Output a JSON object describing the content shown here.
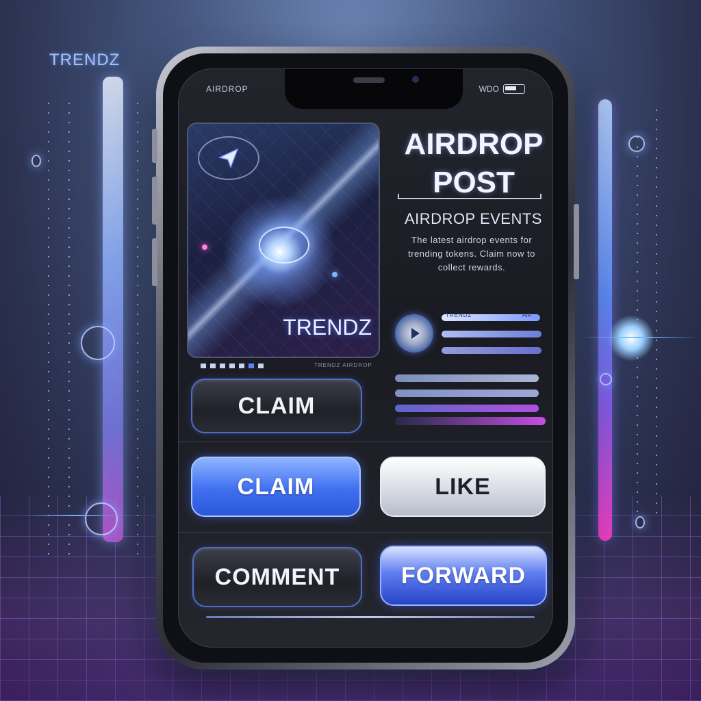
{
  "brand": "TRENDZ",
  "status_bar": {
    "left": "AIRDROP",
    "right": "WDO"
  },
  "hero": {
    "label": "TRENDZ",
    "pager_caption": "TRENDZ AIRDROP"
  },
  "post": {
    "title_line1": "AIRDROP",
    "title_line2": "POST",
    "events_title": "AIRDROP EVENTS",
    "events_body": "The latest airdrop events for trending tokens. Claim now to collect rewards."
  },
  "player": {
    "label": "TRENDZ",
    "end": "AIR"
  },
  "buttons": {
    "claim_top": "CLAIM",
    "claim": "CLAIM",
    "like": "LIKE",
    "comment": "COMMENT",
    "forward": "FORWARD"
  },
  "icons": {
    "hero_nav": "navigation-arrow-icon",
    "play": "play-icon"
  },
  "colors": {
    "accent_blue": "#3f6ff0",
    "accent_magenta": "#c24fe2",
    "screen_bg": "#1a1b22"
  }
}
